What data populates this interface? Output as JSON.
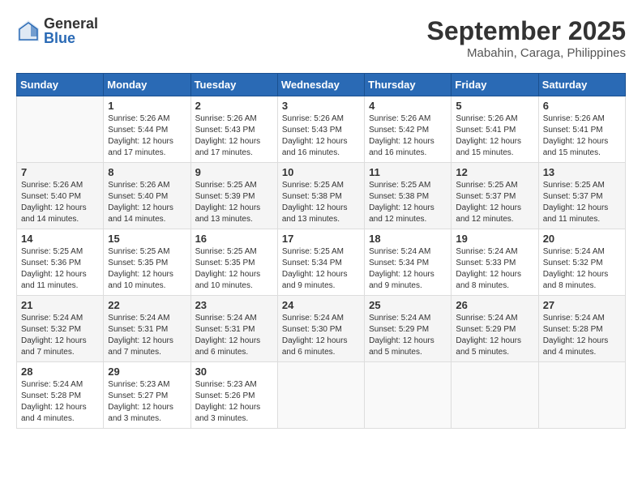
{
  "header": {
    "logo_general": "General",
    "logo_blue": "Blue",
    "month_title": "September 2025",
    "location": "Mabahin, Caraga, Philippines"
  },
  "days_of_week": [
    "Sunday",
    "Monday",
    "Tuesday",
    "Wednesday",
    "Thursday",
    "Friday",
    "Saturday"
  ],
  "weeks": [
    {
      "shaded": false,
      "days": [
        {
          "num": "",
          "info": ""
        },
        {
          "num": "1",
          "info": "Sunrise: 5:26 AM\nSunset: 5:44 PM\nDaylight: 12 hours\nand 17 minutes."
        },
        {
          "num": "2",
          "info": "Sunrise: 5:26 AM\nSunset: 5:43 PM\nDaylight: 12 hours\nand 17 minutes."
        },
        {
          "num": "3",
          "info": "Sunrise: 5:26 AM\nSunset: 5:43 PM\nDaylight: 12 hours\nand 16 minutes."
        },
        {
          "num": "4",
          "info": "Sunrise: 5:26 AM\nSunset: 5:42 PM\nDaylight: 12 hours\nand 16 minutes."
        },
        {
          "num": "5",
          "info": "Sunrise: 5:26 AM\nSunset: 5:41 PM\nDaylight: 12 hours\nand 15 minutes."
        },
        {
          "num": "6",
          "info": "Sunrise: 5:26 AM\nSunset: 5:41 PM\nDaylight: 12 hours\nand 15 minutes."
        }
      ]
    },
    {
      "shaded": true,
      "days": [
        {
          "num": "7",
          "info": "Sunrise: 5:26 AM\nSunset: 5:40 PM\nDaylight: 12 hours\nand 14 minutes."
        },
        {
          "num": "8",
          "info": "Sunrise: 5:26 AM\nSunset: 5:40 PM\nDaylight: 12 hours\nand 14 minutes."
        },
        {
          "num": "9",
          "info": "Sunrise: 5:25 AM\nSunset: 5:39 PM\nDaylight: 12 hours\nand 13 minutes."
        },
        {
          "num": "10",
          "info": "Sunrise: 5:25 AM\nSunset: 5:38 PM\nDaylight: 12 hours\nand 13 minutes."
        },
        {
          "num": "11",
          "info": "Sunrise: 5:25 AM\nSunset: 5:38 PM\nDaylight: 12 hours\nand 12 minutes."
        },
        {
          "num": "12",
          "info": "Sunrise: 5:25 AM\nSunset: 5:37 PM\nDaylight: 12 hours\nand 12 minutes."
        },
        {
          "num": "13",
          "info": "Sunrise: 5:25 AM\nSunset: 5:37 PM\nDaylight: 12 hours\nand 11 minutes."
        }
      ]
    },
    {
      "shaded": false,
      "days": [
        {
          "num": "14",
          "info": "Sunrise: 5:25 AM\nSunset: 5:36 PM\nDaylight: 12 hours\nand 11 minutes."
        },
        {
          "num": "15",
          "info": "Sunrise: 5:25 AM\nSunset: 5:35 PM\nDaylight: 12 hours\nand 10 minutes."
        },
        {
          "num": "16",
          "info": "Sunrise: 5:25 AM\nSunset: 5:35 PM\nDaylight: 12 hours\nand 10 minutes."
        },
        {
          "num": "17",
          "info": "Sunrise: 5:25 AM\nSunset: 5:34 PM\nDaylight: 12 hours\nand 9 minutes."
        },
        {
          "num": "18",
          "info": "Sunrise: 5:24 AM\nSunset: 5:34 PM\nDaylight: 12 hours\nand 9 minutes."
        },
        {
          "num": "19",
          "info": "Sunrise: 5:24 AM\nSunset: 5:33 PM\nDaylight: 12 hours\nand 8 minutes."
        },
        {
          "num": "20",
          "info": "Sunrise: 5:24 AM\nSunset: 5:32 PM\nDaylight: 12 hours\nand 8 minutes."
        }
      ]
    },
    {
      "shaded": true,
      "days": [
        {
          "num": "21",
          "info": "Sunrise: 5:24 AM\nSunset: 5:32 PM\nDaylight: 12 hours\nand 7 minutes."
        },
        {
          "num": "22",
          "info": "Sunrise: 5:24 AM\nSunset: 5:31 PM\nDaylight: 12 hours\nand 7 minutes."
        },
        {
          "num": "23",
          "info": "Sunrise: 5:24 AM\nSunset: 5:31 PM\nDaylight: 12 hours\nand 6 minutes."
        },
        {
          "num": "24",
          "info": "Sunrise: 5:24 AM\nSunset: 5:30 PM\nDaylight: 12 hours\nand 6 minutes."
        },
        {
          "num": "25",
          "info": "Sunrise: 5:24 AM\nSunset: 5:29 PM\nDaylight: 12 hours\nand 5 minutes."
        },
        {
          "num": "26",
          "info": "Sunrise: 5:24 AM\nSunset: 5:29 PM\nDaylight: 12 hours\nand 5 minutes."
        },
        {
          "num": "27",
          "info": "Sunrise: 5:24 AM\nSunset: 5:28 PM\nDaylight: 12 hours\nand 4 minutes."
        }
      ]
    },
    {
      "shaded": false,
      "days": [
        {
          "num": "28",
          "info": "Sunrise: 5:24 AM\nSunset: 5:28 PM\nDaylight: 12 hours\nand 4 minutes."
        },
        {
          "num": "29",
          "info": "Sunrise: 5:23 AM\nSunset: 5:27 PM\nDaylight: 12 hours\nand 3 minutes."
        },
        {
          "num": "30",
          "info": "Sunrise: 5:23 AM\nSunset: 5:26 PM\nDaylight: 12 hours\nand 3 minutes."
        },
        {
          "num": "",
          "info": ""
        },
        {
          "num": "",
          "info": ""
        },
        {
          "num": "",
          "info": ""
        },
        {
          "num": "",
          "info": ""
        }
      ]
    }
  ]
}
